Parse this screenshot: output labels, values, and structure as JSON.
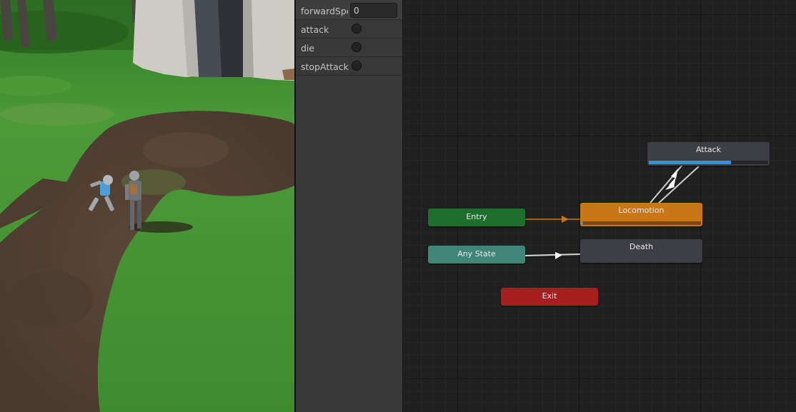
{
  "parameters": [
    {
      "name": "forwardSpeed",
      "display": "forwardSpe",
      "type": "float",
      "value": "0"
    },
    {
      "name": "attack",
      "type": "trigger"
    },
    {
      "name": "die",
      "type": "trigger"
    },
    {
      "name": "stopAttack",
      "type": "trigger"
    }
  ],
  "graph": {
    "states": {
      "attack": {
        "label": "Attack",
        "color": "#3d3f44",
        "progress": 0.69
      },
      "entry": {
        "label": "Entry",
        "color": "#1e6e2e"
      },
      "locomotion": {
        "label": "Locomotion",
        "color": "#c87616",
        "progress": 0.01
      },
      "any_state": {
        "label": "Any State",
        "color": "#3f8679"
      },
      "death": {
        "label": "Death",
        "color": "#3d3f44"
      },
      "exit": {
        "label": "Exit",
        "color": "#a81e1e"
      }
    }
  },
  "colors": {
    "accent": "#3a8ee0",
    "default_transition": "#c87616",
    "transition": "#d8d8d8"
  }
}
